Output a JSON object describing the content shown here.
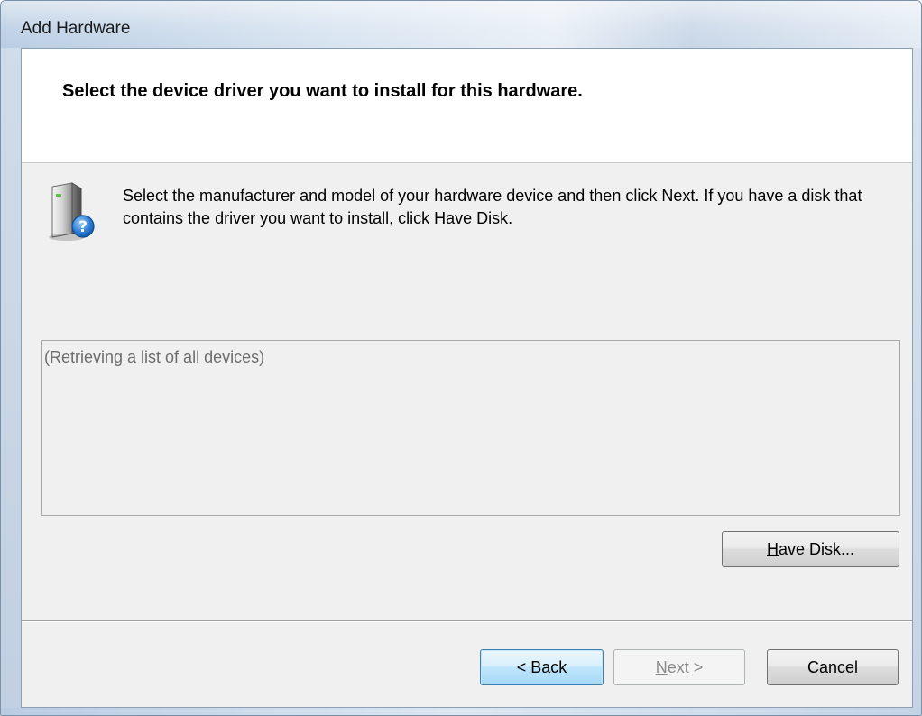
{
  "window": {
    "title": "Add Hardware"
  },
  "header": {
    "title": "Select the device driver you want to install for this hardware."
  },
  "description": {
    "text": "Select the manufacturer and model of your hardware device and then click Next. If you have a disk that contains the driver you want to install, click Have Disk.",
    "icon": "hardware-question-icon"
  },
  "device_list": {
    "status_text": "(Retrieving a list of all devices)"
  },
  "buttons": {
    "have_disk": {
      "accel": "H",
      "rest": "ave Disk..."
    },
    "back": {
      "label": "< Back"
    },
    "next": {
      "accel": "N",
      "rest": "ext >",
      "enabled": false
    },
    "cancel": {
      "label": "Cancel"
    }
  },
  "colors": {
    "default_button_border": "#3c7fb1",
    "disabled_text": "#8a8a8a",
    "client_background": "#f0f0f0"
  }
}
